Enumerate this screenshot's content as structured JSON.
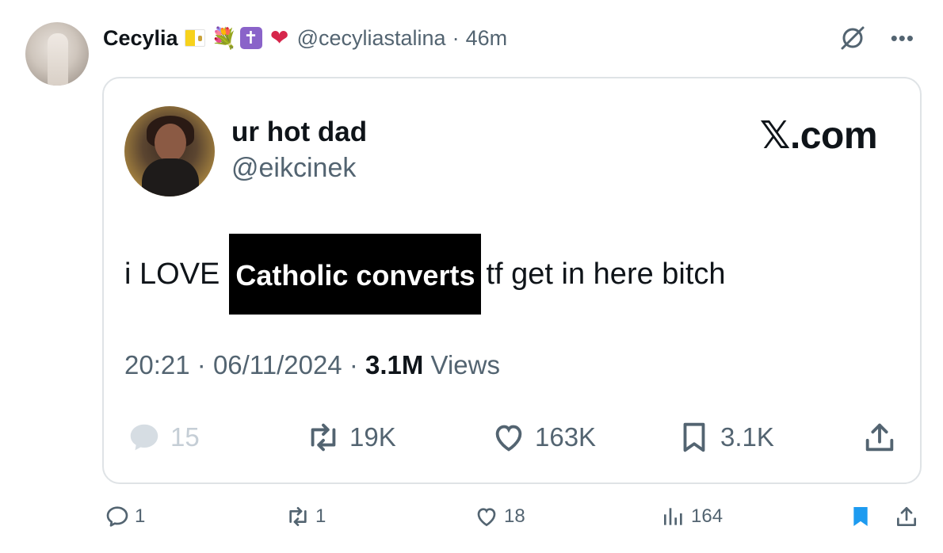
{
  "post": {
    "display_name": "Cecylia",
    "handle": "@cecyliastalina",
    "separator": "·",
    "time_ago": "46m",
    "emoji_icons": [
      "vatican-flag-icon",
      "bouquet-icon",
      "latin-cross-icon",
      "sparkling-heart-icon"
    ]
  },
  "quote": {
    "name": "ur hot dad",
    "handle": "@eikcinek",
    "brand": "𝕏.com",
    "text_before": "i LOVE",
    "text_redacted": "Catholic converts",
    "text_after": "tf get in here bitch",
    "time": "20:21",
    "date": "06/11/2024",
    "views_count": "3.1M",
    "views_label": "Views",
    "actions": {
      "replies": "15",
      "reposts": "19K",
      "likes": "163K",
      "bookmarks": "3.1K"
    }
  },
  "actions": {
    "replies": "1",
    "reposts": "1",
    "likes": "18",
    "views": "164"
  },
  "colors": {
    "text": "#0f1419",
    "muted": "#536471",
    "border": "#dfe3e6",
    "accent": "#1d9bf0"
  }
}
